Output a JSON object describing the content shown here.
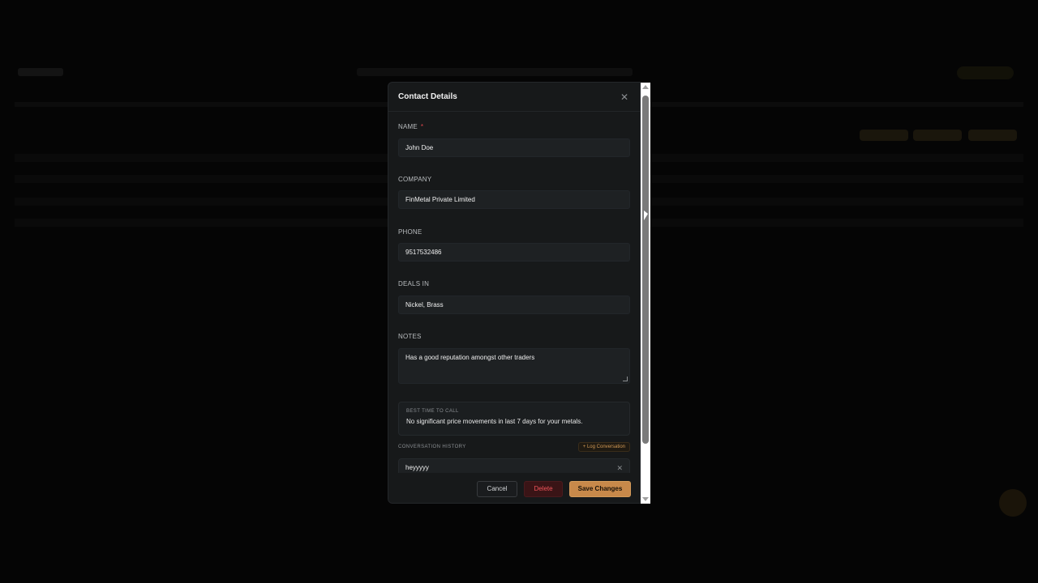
{
  "modal": {
    "title": "Contact Details",
    "close_icon": "close-icon"
  },
  "fields": {
    "name": {
      "label": "NAME",
      "required_mark": "*",
      "value": "John Doe"
    },
    "company": {
      "label": "COMPANY",
      "value": "FinMetal Private Limited"
    },
    "phone": {
      "label": "PHONE",
      "value": "9517532486"
    },
    "deals_in": {
      "label": "DEALS IN",
      "value": "Nickel, Brass"
    },
    "notes": {
      "label": "NOTES",
      "value": "Has a good reputation amongst other traders"
    }
  },
  "best_time": {
    "label": "BEST TIME TO CALL",
    "text": "No significant price movements in last 7 days for your metals."
  },
  "history": {
    "label": "CONVERSATION HISTORY",
    "log_button": "+ Log Conversation",
    "items": [
      {
        "text": "heyyyyy"
      }
    ]
  },
  "footer": {
    "cancel": "Cancel",
    "delete": "Delete",
    "save": "Save Changes"
  },
  "colors": {
    "accent": "#c8894a",
    "danger": "#f0545a"
  }
}
